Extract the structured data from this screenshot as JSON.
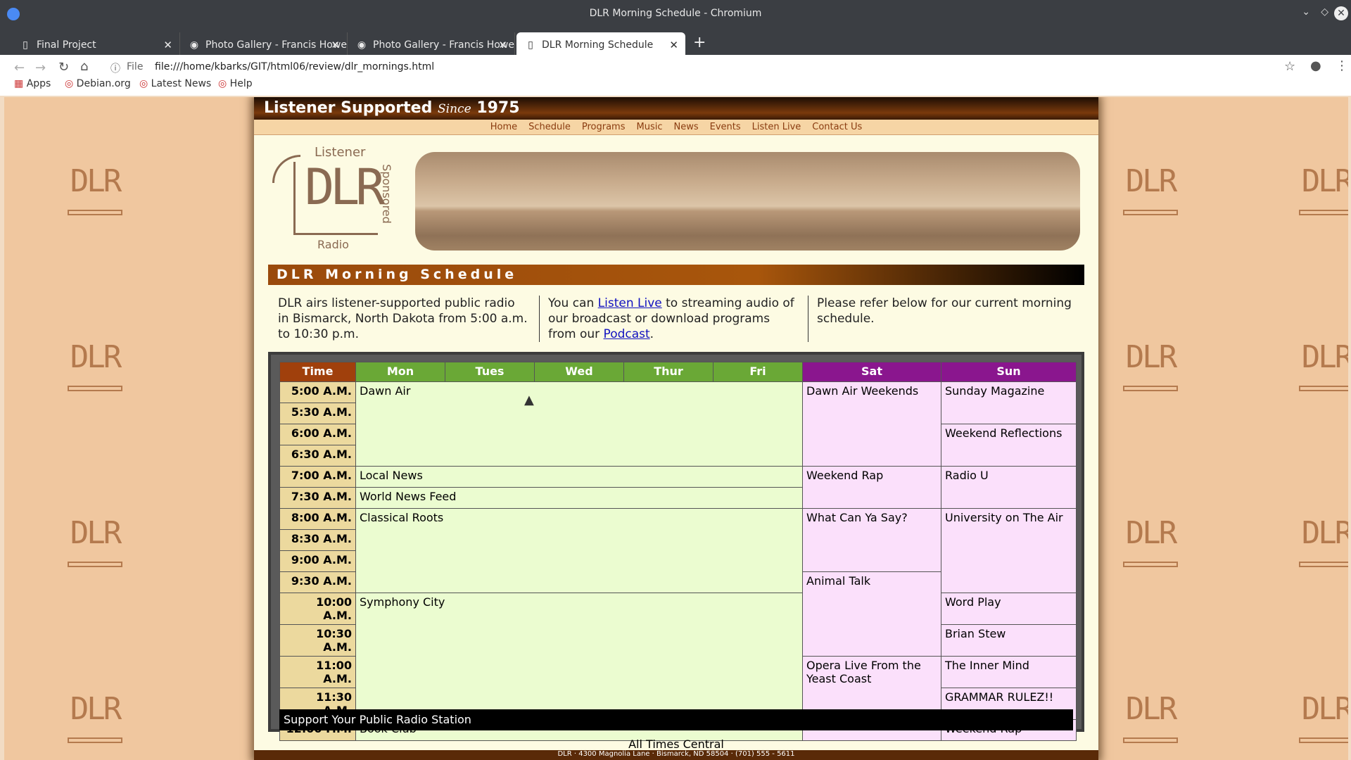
{
  "window": {
    "title": "DLR Morning Schedule - Chromium"
  },
  "tabs": [
    {
      "label": "Final Project",
      "icon": "page-icon"
    },
    {
      "label": "Photo Gallery - Francis Howe",
      "icon": "chrome-icon"
    },
    {
      "label": "Photo Gallery - Francis Howe",
      "icon": "chrome-icon"
    },
    {
      "label": "DLR Morning Schedule",
      "icon": "page-icon",
      "active": true
    }
  ],
  "toolbar": {
    "scheme": "File",
    "url": "file:///home/kbarks/GIT/html06/review/dlr_mornings.html"
  },
  "bookmarks": [
    "Apps",
    "Debian.org",
    "Latest News",
    "Help"
  ],
  "site": {
    "header": "Listener Supported",
    "since": "Since",
    "year": "1975",
    "nav": [
      "Home",
      "Schedule",
      "Programs",
      "Music",
      "News",
      "Events",
      "Listen Live",
      "Contact Us"
    ],
    "logo_top": "Listener",
    "logo_main": "DLR",
    "logo_side": "Sponsored",
    "logo_bottom": "Radio",
    "section_title": "DLR Morning Schedule",
    "col1": "DLR airs listener-supported public radio in Bismarck, North Dakota from 5:00 a.m. to 10:30 p.m.",
    "col2_a": "You can ",
    "col2_link1": "Listen Live",
    "col2_b": " to streaming audio of our broadcast or download programs from our ",
    "col2_link2": "Podcast",
    "col2_c": ".",
    "col3": "Please refer below for our current morning schedule.",
    "tile_text": "DLR",
    "support": "Support Your Public Radio Station",
    "times_note": "All Times Central",
    "address": "DLR · 4300 Magnolia Lane · Bismarck, ND 58504 · (701) 555 - 5611"
  },
  "schedule": {
    "headers": [
      "Time",
      "Mon",
      "Tues",
      "Wed",
      "Thur",
      "Fri",
      "Sat",
      "Sun"
    ],
    "times": [
      "5:00 A.M.",
      "5:30 A.M.",
      "6:00 A.M.",
      "6:30 A.M.",
      "7:00 A.M.",
      "7:30 A.M.",
      "8:00 A.M.",
      "8:30 A.M.",
      "9:00 A.M.",
      "9:30 A.M.",
      "10:00 A.M.",
      "10:30 A.M.",
      "11:00 A.M.",
      "11:30 A.M.",
      "12:00 P.M."
    ],
    "weekday": [
      "Dawn Air",
      "Local News",
      "World News Feed",
      "Classical Roots",
      "Symphony City",
      "Book Club"
    ],
    "sat": [
      "Dawn Air Weekends",
      "Weekend Rap",
      "What Can Ya Say?",
      "Animal Talk",
      "Opera Live From the Yeast Coast"
    ],
    "sun": [
      "Sunday Magazine",
      "Weekend Reflections",
      "Radio U",
      "University on The Air",
      "Word Play",
      "Brian Stew",
      "The Inner Mind",
      "GRAMMAR RULEZ!!",
      "Weekend Rap"
    ]
  }
}
